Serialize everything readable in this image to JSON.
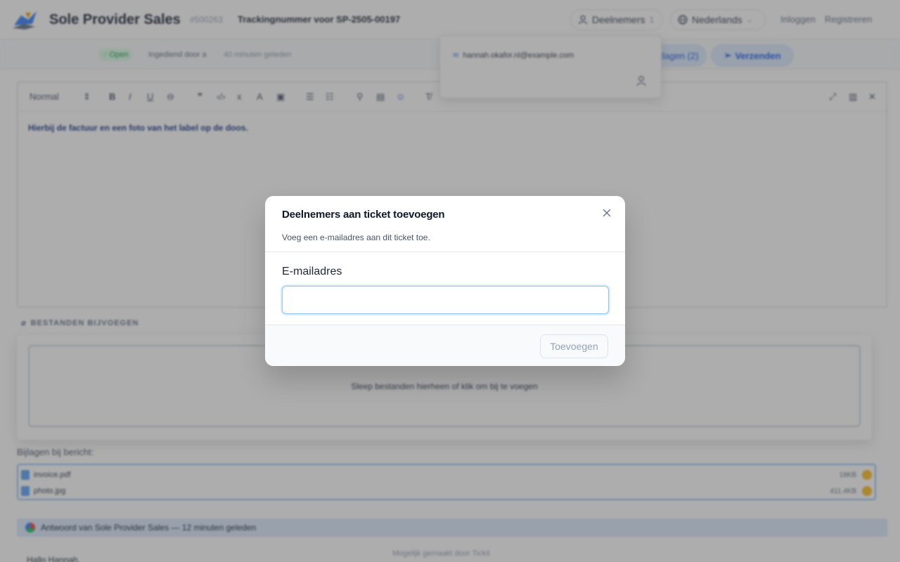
{
  "header": {
    "brand": "Sole Provider Sales",
    "ticket_id": "#500263",
    "ticket_title": "Trackingnummer voor SP-2505-00197",
    "participants_label": "Deelnemers",
    "participants_count": "1",
    "language": "Nederlands",
    "login": "Inloggen",
    "register": "Registreren"
  },
  "status_bar": {
    "status": "Open",
    "submitted_by": "Ingediend door a",
    "time_ago": "40 minuten geleden",
    "attach_button": "ijlagen (2)",
    "send_button": "Verzenden"
  },
  "participants_dropdown": {
    "email": "hannah.okafor.nl@example.com"
  },
  "editor": {
    "format": "Normal",
    "body_text": "Hierbij de factuur en een foto van het label op de doos."
  },
  "attachments": {
    "heading": "BESTANDEN BIJVOEGEN",
    "dropzone_text": "Sleep bestanden hierheen of klik om bij te voegen",
    "list_label": "Bijlagen bij bericht:",
    "files": [
      {
        "name": "invoice.pdf",
        "size": "18KB"
      },
      {
        "name": "photo.jpg",
        "size": "411.4KB"
      }
    ]
  },
  "reply": {
    "header": "Antwoord van Sole Provider Sales — 12 minuten geleden",
    "greeting": "Hallo Hannah,"
  },
  "footer": {
    "powered_by": "Mogelijk gemaakt door Tickit"
  },
  "modal": {
    "title": "Deelnemers aan ticket toevoegen",
    "description": "Voeg een e-mailadres aan dit ticket toe.",
    "email_label": "E-mailadres",
    "email_value": "",
    "email_placeholder": "",
    "add_button": "Toevoegen"
  },
  "colors": {
    "accent": "#2563eb",
    "overlay": "#3c3c3c",
    "input_focus": "#93c5fd"
  }
}
